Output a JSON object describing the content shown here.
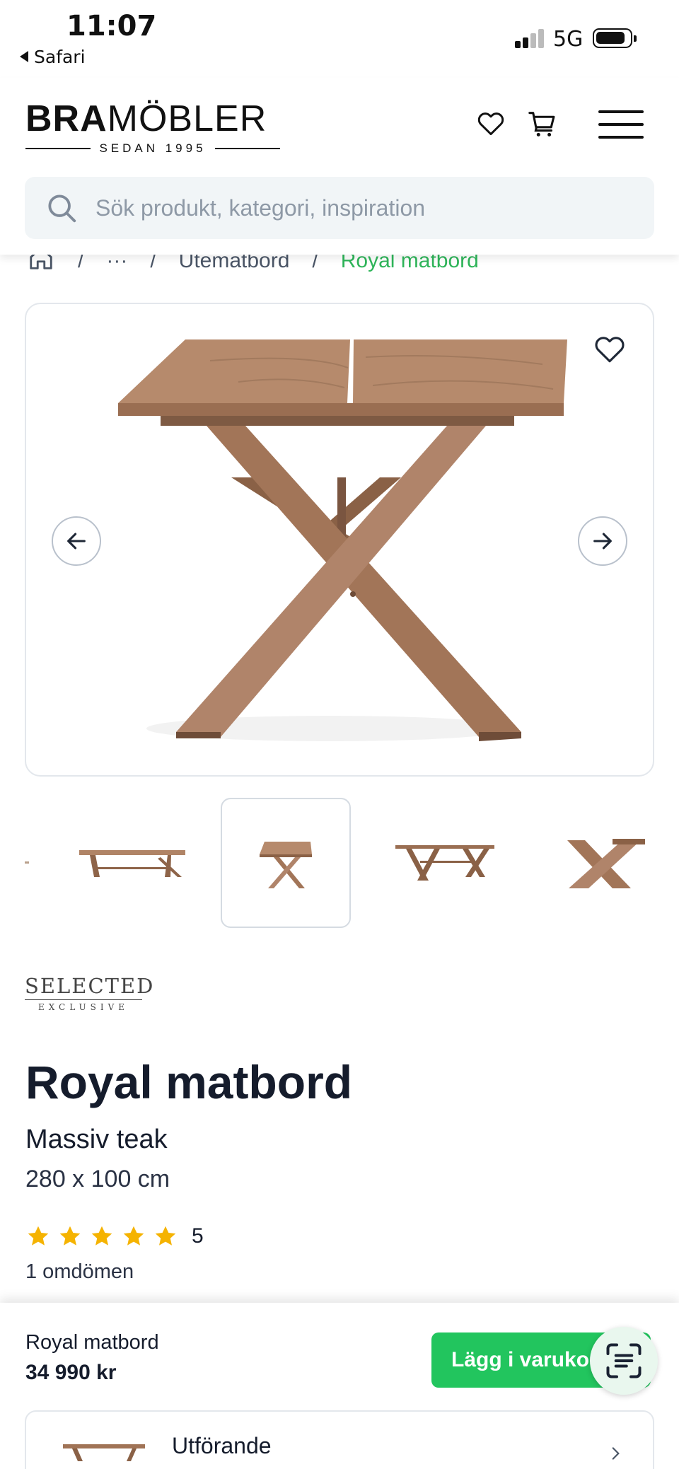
{
  "status_bar": {
    "time": "11:07",
    "back_app": "Safari",
    "network": "5G"
  },
  "header": {
    "logo_bold": "BRA",
    "logo_light": "MÖBLER",
    "logo_sub": "SEDAN 1995",
    "search_placeholder": "Sök produkt, kategori, inspiration",
    "icons": [
      "heart-icon",
      "cart-icon",
      "menu-icon",
      "search-icon"
    ]
  },
  "breadcrumb": {
    "ellipsis": "···",
    "category": "Utematbord",
    "current": "Royal matbord",
    "separator": "/"
  },
  "gallery": {
    "thumbnails": [
      "partial",
      "front",
      "angle",
      "side",
      "detail"
    ],
    "selected_index": 2
  },
  "product": {
    "brand_line1": "SELECTED",
    "brand_line2": "EXCLUSIVE",
    "title": "Royal matbord",
    "material": "Massiv teak",
    "dimensions": "280 x 100 cm",
    "rating": 5,
    "rating_text": "5",
    "reviews": "1 omdömen"
  },
  "sticky_bar": {
    "name": "Royal matbord",
    "price": "34 990 kr",
    "add_to_cart": "Lägg i varukorg",
    "variant_label": "Utförande"
  },
  "colors": {
    "accent_green": "#22c55e",
    "breadcrumb_current": "#2fb55a",
    "star": "#f5b301",
    "wood": "#a07356"
  }
}
